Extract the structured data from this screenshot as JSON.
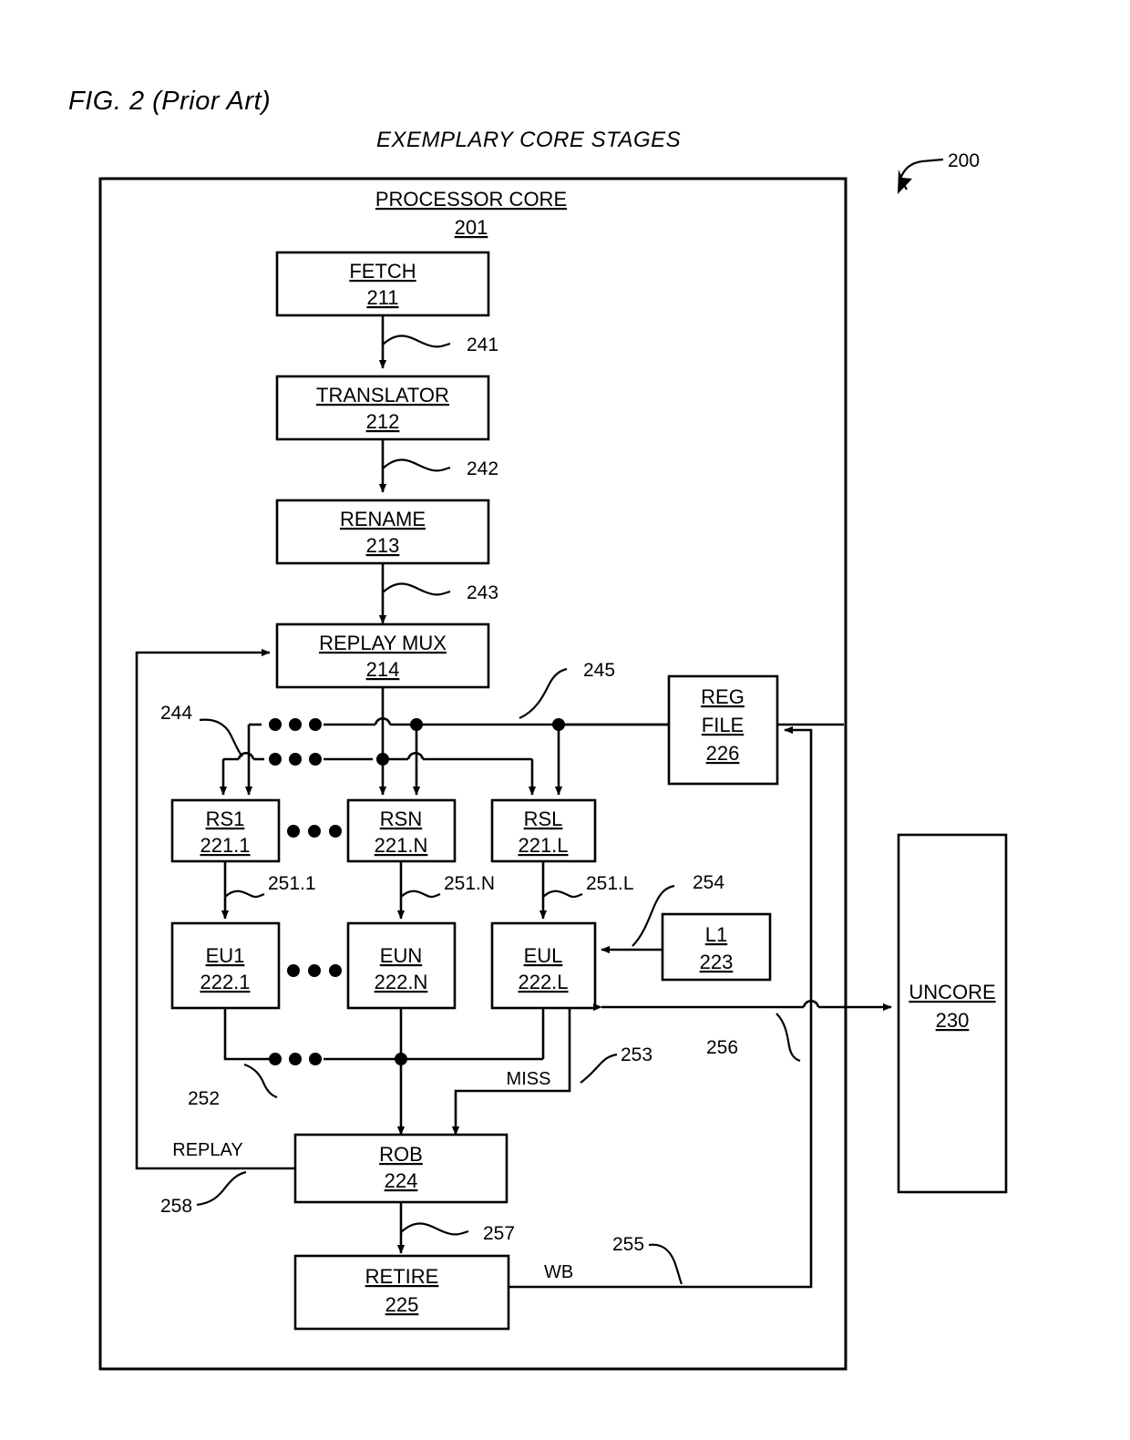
{
  "figure": {
    "title": "FIG. 2 (Prior Art)",
    "subtitle": "EXEMPLARY CORE STAGES",
    "callout": "200"
  },
  "core": {
    "title": "PROCESSOR CORE",
    "ref": "201"
  },
  "blocks": {
    "fetch": {
      "name": "FETCH",
      "ref": "211"
    },
    "translator": {
      "name": "TRANSLATOR",
      "ref": "212"
    },
    "rename": {
      "name": "RENAME",
      "ref": "213"
    },
    "replay_mux": {
      "name": "REPLAY MUX",
      "ref": "214"
    },
    "rs1": {
      "name": "RS1",
      "ref": "221.1"
    },
    "rsn": {
      "name": "RSN",
      "ref": "221.N"
    },
    "rsl": {
      "name": "RSL",
      "ref": "221.L"
    },
    "eu1": {
      "name": "EU1",
      "ref": "222.1"
    },
    "eun": {
      "name": "EUN",
      "ref": "222.N"
    },
    "eul": {
      "name": "EUL",
      "ref": "222.L"
    },
    "l1": {
      "name": "L1",
      "ref": "223"
    },
    "rob": {
      "name": "ROB",
      "ref": "224"
    },
    "retire": {
      "name": "RETIRE",
      "ref": "225"
    },
    "reg_file": {
      "name": "REG",
      "name2": "FILE",
      "ref": "226"
    },
    "uncore": {
      "name": "UNCORE",
      "ref": "230"
    }
  },
  "signal_refs": {
    "s241": "241",
    "s242": "242",
    "s243": "243",
    "s244": "244",
    "s245": "245",
    "s251_1": "251.1",
    "s251_n": "251.N",
    "s251_l": "251.L",
    "s252": "252",
    "s253": "253",
    "s254": "254",
    "s255": "255",
    "s256": "256",
    "s257": "257",
    "s258": "258"
  },
  "signal_labels": {
    "miss": "MISS",
    "replay": "REPLAY",
    "wb": "WB"
  }
}
